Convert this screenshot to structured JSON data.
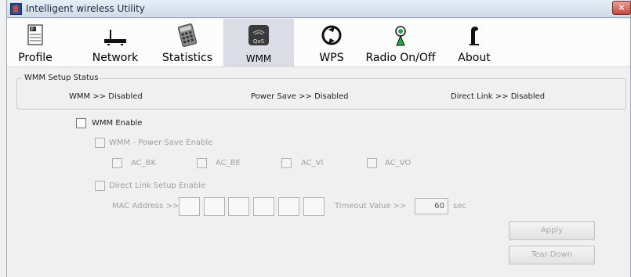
{
  "window": {
    "title": "Intelligent wireless Utility",
    "close_label": "×"
  },
  "toolbar": {
    "items": [
      {
        "label": "Profile",
        "icon": "profile-icon"
      },
      {
        "label": "Network",
        "icon": "network-icon"
      },
      {
        "label": "Statistics",
        "icon": "statistics-icon"
      },
      {
        "label": "WMM",
        "icon": "qos-icon",
        "icon_text": "QoS",
        "active": true
      },
      {
        "label": "WPS",
        "icon": "wps-icon"
      },
      {
        "label": "Radio On/Off",
        "icon": "radio-icon"
      },
      {
        "label": "About",
        "icon": "about-icon"
      }
    ]
  },
  "status": {
    "legend": "WMM Setup Status",
    "wmm": "WMM >> Disabled",
    "power_save": "Power Save >> Disabled",
    "direct_link": "Direct Link >> Disabled"
  },
  "settings": {
    "wmm_enable": "WMM Enable",
    "power_save_enable": "WMM - Power Save Enable",
    "ac_bk": "AC_BK",
    "ac_be": "AC_BE",
    "ac_vi": "AC_VI",
    "ac_vo": "AC_VO",
    "dls_enable": "Direct Link Setup Enable",
    "mac_label": "MAC Address >>",
    "timeout_label": "Timeout Value >>",
    "timeout_value": "60",
    "timeout_unit": "sec"
  },
  "buttons": {
    "apply": "Apply",
    "tear_down": "Tear Down"
  },
  "colors": {
    "active_tab": "#dadce6",
    "disabled_text": "#a0a0a0"
  }
}
